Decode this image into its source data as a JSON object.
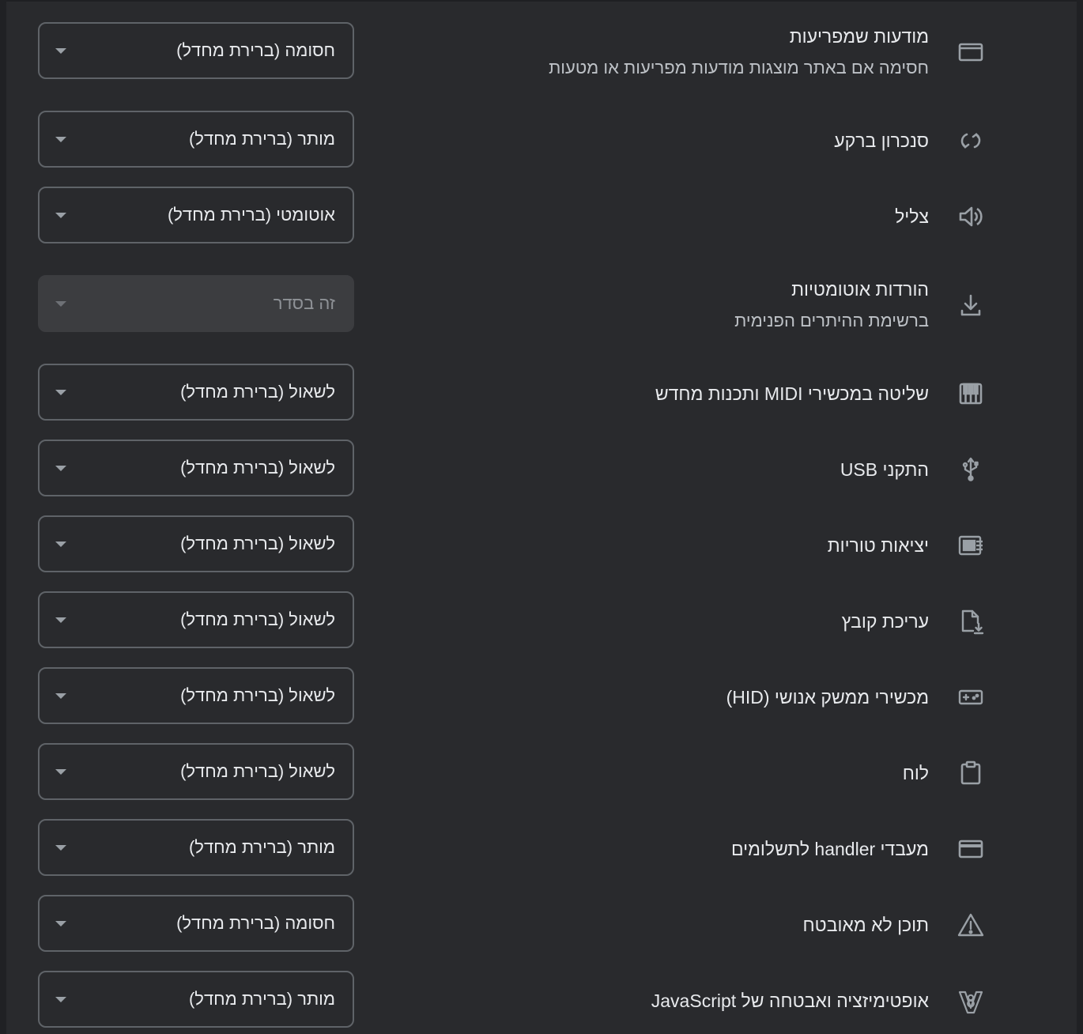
{
  "colors": {
    "background": "#292a2d",
    "text": "#e8eaed",
    "secondary_text": "#bdc1c6",
    "border": "#5f6368",
    "disabled_bg": "#3c3d40"
  },
  "settings": [
    {
      "icon": "popup-window-icon",
      "title": "מודעות שמפריעות",
      "subtitle": "חסימה אם באתר מוצגות מודעות מפריעות או מטעות",
      "value": "חסומה (ברירת מחדל)",
      "disabled": false
    },
    {
      "icon": "background-sync-icon",
      "title": "סנכרון ברקע",
      "value": "מותר (ברירת מחדל)",
      "disabled": false
    },
    {
      "icon": "speaker-icon",
      "title": "צליל",
      "value": "אוטומטי (ברירת מחדל)",
      "disabled": false
    },
    {
      "icon": "download-icon",
      "title": "הורדות אוטומטיות",
      "subtitle": "ברשימת ההיתרים הפנימית",
      "value": "זה בסדר",
      "disabled": true
    },
    {
      "icon": "piano-icon",
      "title": "שליטה במכשירי MIDI ותכנות מחדש",
      "value": "לשאול (ברירת מחדל)",
      "disabled": false
    },
    {
      "icon": "usb-icon",
      "title": "התקני USB",
      "value": "לשאול (ברירת מחדל)",
      "disabled": false
    },
    {
      "icon": "serial-port-icon",
      "title": "יציאות טוריות",
      "value": "לשאול (ברירת מחדל)",
      "disabled": false
    },
    {
      "icon": "file-edit-icon",
      "title": "עריכת קובץ",
      "value": "לשאול (ברירת מחדל)",
      "disabled": false
    },
    {
      "icon": "gamepad-icon",
      "title": "מכשירי ממשק אנושי (HID)",
      "value": "לשאול (ברירת מחדל)",
      "disabled": false
    },
    {
      "icon": "clipboard-icon",
      "title": "לוח",
      "value": "לשאול (ברירת מחדל)",
      "disabled": false
    },
    {
      "icon": "payment-card-icon",
      "title": "מעבדי handler לתשלומים",
      "value": "מותר (ברירת מחדל)",
      "disabled": false
    },
    {
      "icon": "warning-icon",
      "title": "תוכן לא מאובטח",
      "value": "חסומה (ברירת מחדל)",
      "disabled": false
    },
    {
      "icon": "v8-icon",
      "title": "אופטימיזציה ואבטחה של JavaScript",
      "value": "מותר (ברירת מחדל)",
      "disabled": false
    }
  ]
}
